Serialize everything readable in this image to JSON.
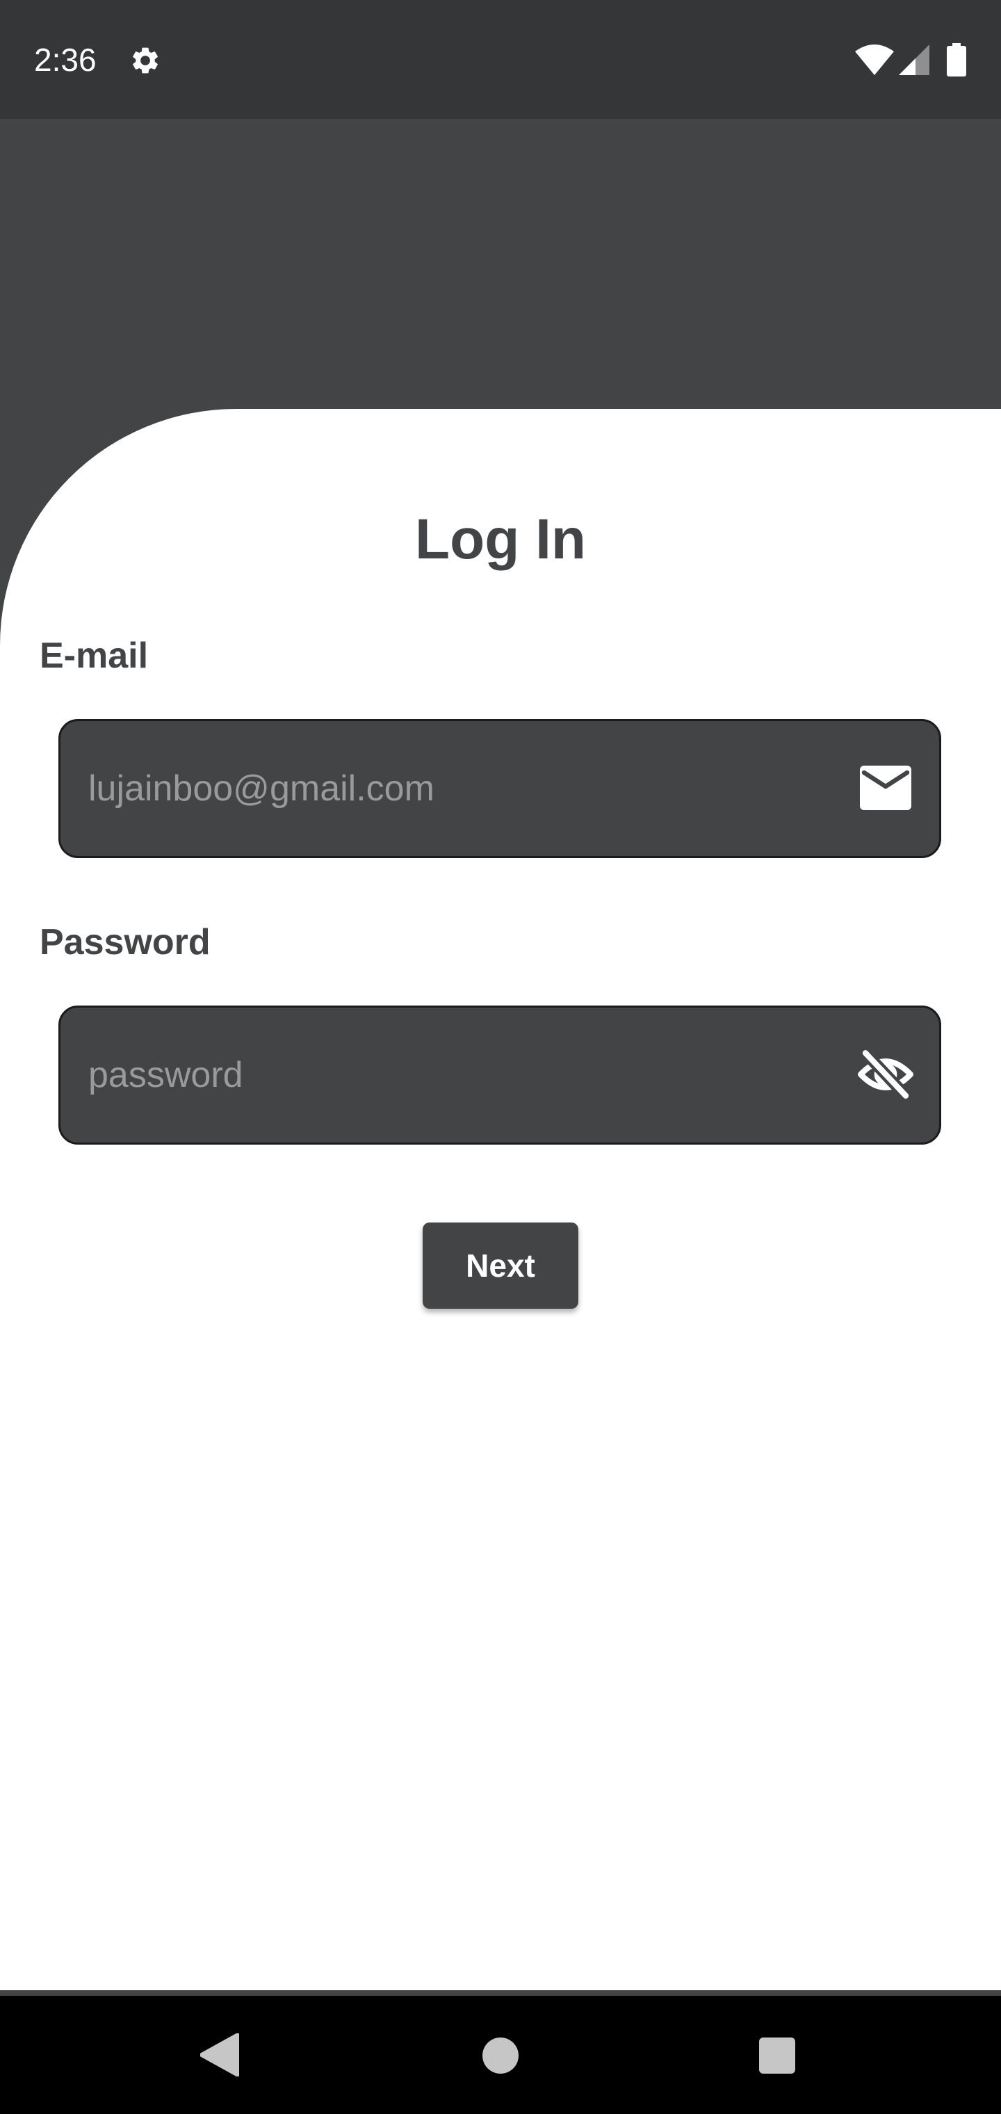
{
  "status_bar": {
    "time": "2:36",
    "icons": [
      "gear-icon",
      "wifi-icon",
      "signal-icon",
      "battery-icon"
    ]
  },
  "login": {
    "title": "Log In",
    "email": {
      "label": "E-mail",
      "placeholder": "lujainboo@gmail.com",
      "icon": "mail-icon"
    },
    "password": {
      "label": "Password",
      "placeholder": "password",
      "icon": "eye-off-icon"
    },
    "next_label": "Next"
  },
  "nav_bar": {
    "icons": [
      "back-icon",
      "home-icon",
      "recents-icon"
    ]
  },
  "colors": {
    "status_bar": "#353638",
    "header": "#434446",
    "field_bg": "#434446",
    "text_dark": "#434446",
    "button_bg": "#434446",
    "button_text": "#ffffff"
  }
}
